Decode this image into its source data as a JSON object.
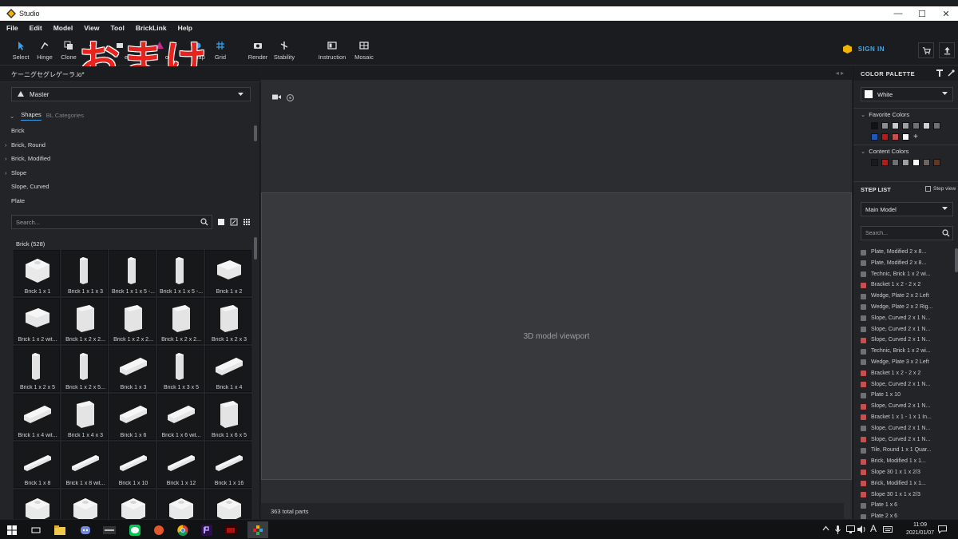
{
  "window": {
    "title": "Studio"
  },
  "menu": [
    "File",
    "Edit",
    "Model",
    "View",
    "Tool",
    "BrickLink",
    "Help"
  ],
  "toolbar": {
    "tools": [
      {
        "label": "Select",
        "icon": "cursor-icon"
      },
      {
        "label": "Hinge",
        "icon": "hinge-icon"
      },
      {
        "label": "Clone",
        "icon": "clone-icon"
      },
      {
        "label": "Snap",
        "icon": "snap-icon"
      },
      {
        "label": "Grid",
        "icon": "grid-icon"
      },
      {
        "label": "Render",
        "icon": "camera-icon"
      },
      {
        "label": "Stability",
        "icon": "stability-icon"
      },
      {
        "label": "Instruction",
        "icon": "instruction-icon"
      },
      {
        "label": "Mosaic",
        "icon": "mosaic-icon"
      }
    ],
    "partial_labels": [
      "ect",
      "on"
    ],
    "sign_in": "SIGN IN"
  },
  "overlay_text": "おまけ",
  "document": {
    "name": "ケーニグセグレゲーラ.io*"
  },
  "left_panel": {
    "master_select": "Master",
    "tabs": {
      "shapes": "Shapes",
      "bl_categories": "BL Categories"
    },
    "categories": [
      {
        "label": "Brick",
        "expandable": false
      },
      {
        "label": "Brick, Round",
        "expandable": true
      },
      {
        "label": "Brick, Modified",
        "expandable": true
      },
      {
        "label": "Slope",
        "expandable": true
      },
      {
        "label": "Slope, Curved",
        "expandable": false
      },
      {
        "label": "Plate",
        "expandable": false
      }
    ],
    "search_placeholder": "Search...",
    "brick_header": "Brick (528)",
    "bricks": [
      "Brick 1 x 1",
      "Brick 1 x 1 x 3",
      "Brick 1 x 1 x 5 -...",
      "Brick 1 x 1 x 5 -...",
      "Brick 1 x 2",
      "Brick 1 x 2 wit...",
      "Brick 1 x 2 x 2...",
      "Brick 1 x 2 x 2...",
      "Brick 1 x 2 x 2...",
      "Brick 1 x 2 x 3",
      "Brick 1 x 2 x 5",
      "Brick 1 x 2 x 5...",
      "Brick 1 x 3",
      "Brick 1 x 3 x 5",
      "Brick 1 x 4",
      "Brick 1 x 4 wit...",
      "Brick 1 x 4 x 3",
      "Brick 1 x 6",
      "Brick 1 x 6 wit...",
      "Brick 1 x 6 x 5",
      "Brick 1 x 8",
      "Brick 1 x 8 wit...",
      "Brick 1 x 10",
      "Brick 1 x 12",
      "Brick 1 x 16",
      "",
      "",
      "",
      "",
      ""
    ]
  },
  "viewport": {
    "total_parts": "363 total parts",
    "placeholder_label": "3D model viewport"
  },
  "right_panel": {
    "color_palette_title": "COLOR PALETTE",
    "selected_color": "White",
    "favorite_title": "Favorite Colors",
    "favorite_colors": [
      "#111417",
      "#8a8c8e",
      "#c9cacb",
      "#9e9fa0",
      "#6e7073",
      "#cfd0d1",
      "#6e7073",
      "#2158b5",
      "#b41c1c",
      "#c45050",
      "#ffffff"
    ],
    "content_title": "Content Colors",
    "content_colors": [
      "#1a1b1d",
      "#b41c1c",
      "#6e7073",
      "#9e9fa0",
      "#ffffff",
      "#6e6560",
      "#5a3b28"
    ],
    "step_list_title": "STEP LIST",
    "step_view": "Step view",
    "model_select": "Main Model",
    "search_placeholder": "Search...",
    "steps": [
      {
        "label": "Plate, Modified 2 x 8...",
        "color": "#6e7073"
      },
      {
        "label": "Plate, Modified 2 x 8...",
        "color": "#6e7073"
      },
      {
        "label": "Technic, Brick 1 x 2 wi...",
        "color": "#6e7073"
      },
      {
        "label": "Bracket 1 x 2 - 2 x 2",
        "color": "#c45050"
      },
      {
        "label": "Wedge, Plate 2 x 2 Left",
        "color": "#6e7073"
      },
      {
        "label": "Wedge, Plate 2 x 2 Rig...",
        "color": "#6e7073"
      },
      {
        "label": "Slope, Curved 2 x 1 N...",
        "color": "#6e7073"
      },
      {
        "label": "Slope, Curved 2 x 1 N...",
        "color": "#6e7073"
      },
      {
        "label": "Slope, Curved 2 x 1 N...",
        "color": "#c45050"
      },
      {
        "label": "Technic, Brick 1 x 2 wi...",
        "color": "#6e7073"
      },
      {
        "label": "Wedge, Plate 3 x 2 Left",
        "color": "#6e7073"
      },
      {
        "label": "Bracket 1 x 2 - 2 x 2",
        "color": "#c45050"
      },
      {
        "label": "Slope, Curved 2 x 1 N...",
        "color": "#c45050"
      },
      {
        "label": "Plate 1 x 10",
        "color": "#6e7073"
      },
      {
        "label": "Slope, Curved 2 x 1 N...",
        "color": "#c45050"
      },
      {
        "label": "Bracket 1 x 1 - 1 x 1 In...",
        "color": "#c45050"
      },
      {
        "label": "Slope, Curved 2 x 1 N...",
        "color": "#6e7073"
      },
      {
        "label": "Slope, Curved 2 x 1 N...",
        "color": "#c45050"
      },
      {
        "label": "Tile, Round 1 x 1 Quar...",
        "color": "#6e7073"
      },
      {
        "label": "Brick, Modified 1 x 1...",
        "color": "#c45050"
      },
      {
        "label": "Slope 30 1 x 1 x 2/3",
        "color": "#c45050"
      },
      {
        "label": "Brick, Modified 1 x 1...",
        "color": "#c45050"
      },
      {
        "label": "Slope 30 1 x 1 x 2/3",
        "color": "#c45050"
      },
      {
        "label": "Plate 1 x 6",
        "color": "#6e7073"
      },
      {
        "label": "Plate 2 x 6",
        "color": "#6e7073"
      }
    ]
  },
  "taskbar": {
    "time": "11:09",
    "date": "2021/01/07",
    "ime": "A"
  },
  "colors": {
    "accent": "#3aa0e8",
    "overlay_red": "#e8231e",
    "panel": "#232428"
  }
}
